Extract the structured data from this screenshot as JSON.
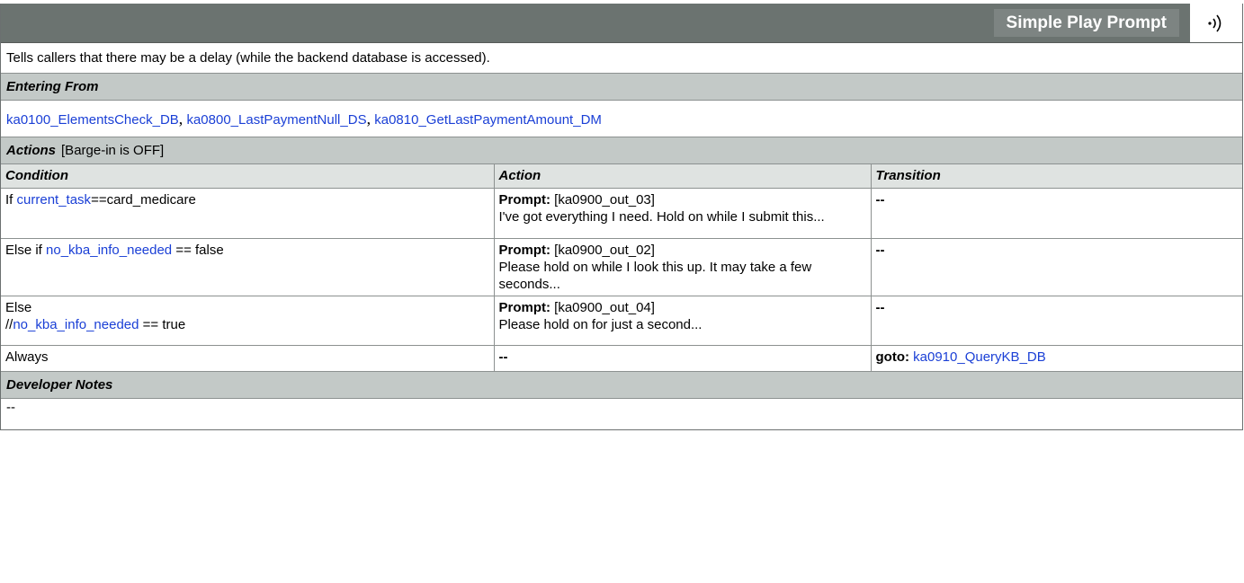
{
  "header": {
    "title": "Simple Play Prompt",
    "icon": "speaker-icon"
  },
  "description": "Tells callers that there may be a delay (while the backend database is accessed).",
  "entering_from": {
    "heading": "Entering From",
    "links": [
      "ka0100_ElementsCheck_DB",
      "ka0800_LastPaymentNull_DS",
      "ka0810_GetLastPaymentAmount_DM"
    ],
    "separator": ","
  },
  "actions": {
    "heading": "Actions",
    "note": "[Barge-in is OFF]",
    "columns": [
      "Condition",
      "Action",
      "Transition"
    ],
    "rows": [
      {
        "cond_prefix": "If ",
        "cond_link": "current_task",
        "cond_suffix": "==card_medicare",
        "prompt_label": "Prompt:",
        "prompt_id": "[ka0900_out_03]",
        "prompt_text": "I've got everything I need. Hold on while I submit this...",
        "transition": "--"
      },
      {
        "cond_prefix": "Else if ",
        "cond_link": "no_kba_info_needed",
        "cond_suffix": " == false",
        "prompt_label": "Prompt:",
        "prompt_id": "[ka0900_out_02]",
        "prompt_text": "Please hold on while I look this up. It may take a few seconds...",
        "transition": "--"
      },
      {
        "cond_line1": "Else",
        "cond_prefix": "//",
        "cond_link": "no_kba_info_needed",
        "cond_suffix": " == true",
        "prompt_label": "Prompt:",
        "prompt_id": "[ka0900_out_04]",
        "prompt_text": "Please hold on for just a second...",
        "transition": "--"
      },
      {
        "condition": "Always",
        "action": "--",
        "transition_label": "goto:",
        "transition_link": "ka0910_QueryKB_DB"
      }
    ]
  },
  "developer_notes": {
    "heading": "Developer Notes",
    "body": "--"
  }
}
